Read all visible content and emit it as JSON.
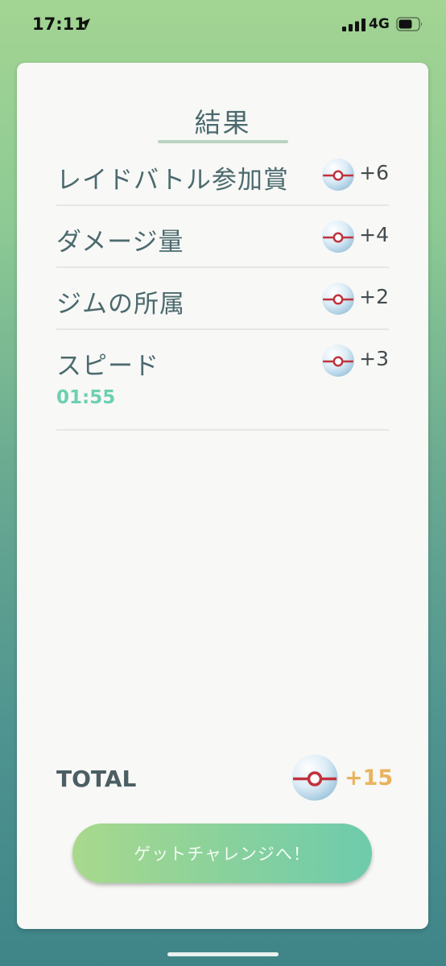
{
  "status_bar": {
    "time": "17:11",
    "network": "4G",
    "location_icon": "location-arrow-icon",
    "signal_icon": "cellular-signal-icon",
    "battery_icon": "battery-icon"
  },
  "results": {
    "title": "結果",
    "items": [
      {
        "label": "レイドバトル参加賞",
        "value": "+6",
        "icon": "premier-ball-icon"
      },
      {
        "label": "ダメージ量",
        "value": "+4",
        "icon": "premier-ball-icon"
      },
      {
        "label": "ジムの所属",
        "value": "+2",
        "icon": "premier-ball-icon"
      },
      {
        "label": "スピード",
        "value": "+3",
        "icon": "premier-ball-icon",
        "sub": "01:55"
      }
    ],
    "total_label": "TOTAL",
    "total_value": "+15"
  },
  "cta": {
    "label": "ゲットチャレンジへ！"
  },
  "colors": {
    "accent_teal": "#6cd0b1",
    "total_gold": "#e9b35e",
    "text_slate": "#4b6a6e"
  }
}
